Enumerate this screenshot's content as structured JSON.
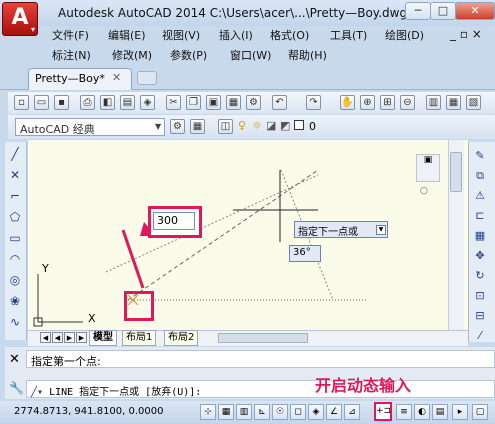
{
  "window": {
    "title": "Autodesk AutoCAD 2014     C:\\Users\\acer\\...\\Pretty—Boy.dwg",
    "minimize": "─",
    "maximize": "□",
    "close": "✕"
  },
  "menu": {
    "row1": [
      "文件(F)",
      "编辑(E)",
      "视图(V)",
      "插入(I)",
      "格式(O)",
      "工具(T)",
      "绘图(D)"
    ],
    "row2": [
      "标注(N)",
      "修改(M)",
      "参数(P)",
      "窗口(W)",
      "帮助(H)"
    ],
    "doc_controls": "_ ▫ ×"
  },
  "tabs": {
    "document": "Pretty—Boy*",
    "close": "✕"
  },
  "toolbar": {
    "workspace": "AutoCAD 经典",
    "layer_value": "0"
  },
  "canvas": {
    "input_value": "300",
    "tooltip": "指定下一点或",
    "angle": "36°",
    "ucs_y": "Y",
    "ucs_x": "X"
  },
  "layout_tabs": [
    "模型",
    "布局1",
    "布局2"
  ],
  "command": {
    "history": "指定第一个点:",
    "prompt": "LINE 指定下一点或 [放弃(U)]:",
    "annotation": "开启动态输入"
  },
  "status": {
    "coords": "2774.8713, 941.8100, 0.0000"
  },
  "colors": {
    "highlight": "#e0185a",
    "canvas": "#fbfbe9"
  }
}
